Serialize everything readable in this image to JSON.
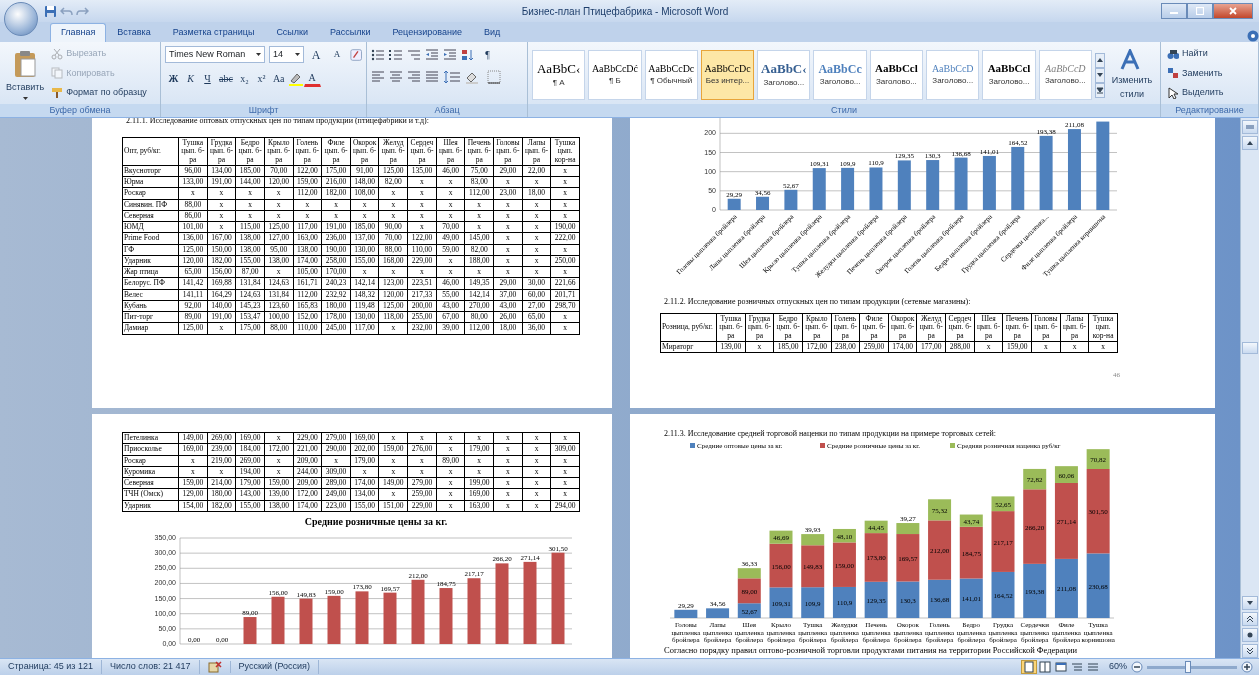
{
  "window": {
    "title": "Бизнес-план Птицефабрика - Microsoft Word"
  },
  "ribbon_tabs": [
    {
      "label": "Главная",
      "selected": true
    },
    {
      "label": "Вставка",
      "selected": false
    },
    {
      "label": "Разметка страницы",
      "selected": false
    },
    {
      "label": "Ссылки",
      "selected": false
    },
    {
      "label": "Рассылки",
      "selected": false
    },
    {
      "label": "Рецензирование",
      "selected": false
    },
    {
      "label": "Вид",
      "selected": false
    }
  ],
  "clipboard": {
    "paste": "Вставить",
    "cut": {
      "label": "Вырезать",
      "disabled": true
    },
    "copy": {
      "label": "Копировать",
      "disabled": true
    },
    "format_painter": {
      "label": "Формат по образцу",
      "disabled": false
    },
    "group_label": "Буфер обмена"
  },
  "font": {
    "name": "Times New Roman",
    "size": "14",
    "grow": "A",
    "shrink": "A",
    "buttons": [
      "Ж",
      "К",
      "Ч",
      "abc",
      "x₂",
      "x²",
      "Aa"
    ],
    "font_color": "A",
    "group_label": "Шрифт"
  },
  "paragraph": {
    "show_marks": "¶",
    "group_label": "Абзац"
  },
  "styles": {
    "items": [
      {
        "preview": "AaBbC‹",
        "name": "¶ А",
        "kind": "large",
        "selected": false
      },
      {
        "preview": "AaBbCcDć",
        "name": "¶ Б",
        "kind": "body",
        "selected": false
      },
      {
        "preview": "AaBbCcDc",
        "name": "¶ Обычный",
        "kind": "body",
        "selected": false
      },
      {
        "preview": "AaBbCcDc",
        "name": "Без интер...",
        "kind": "body",
        "selected": true
      },
      {
        "preview": "AaBbC‹",
        "name": "Заголово...",
        "kind": "heading",
        "selected": false
      },
      {
        "preview": "AaBbCc",
        "name": "Заголово...",
        "kind": "subheading",
        "selected": false
      },
      {
        "preview": "AaBbCcl",
        "name": "Заголово...",
        "kind": "strong",
        "selected": false
      },
      {
        "preview": "AaBbCcD",
        "name": "Заголово...",
        "kind": "subtle",
        "selected": false
      },
      {
        "preview": "AaBbCcl",
        "name": "Заголово...",
        "kind": "strong",
        "selected": false
      },
      {
        "preview": "AaBbCcD",
        "name": "Заголово...",
        "kind": "emphasis",
        "selected": false
      }
    ],
    "change_label": "Изменить стили",
    "group_label": "Стили"
  },
  "editing": {
    "find": "Найти",
    "replace": "Заменить",
    "select": "Выделить",
    "group_label": "Редактирование"
  },
  "wholesale_page": {
    "heading": "2.11.1.    Исследование оптовых отпускных цен по типам продукции (птицефабрики и т.д):",
    "table": {
      "columns": [
        "Опт, руб/кг.",
        "Тушка цып. б-ра",
        "Грудка цып. б-ра",
        "Бедро цып. б-ра",
        "Крыло цып. б-ра",
        "Голень цып. б-ра",
        "Филе цып. б-ра",
        "Окорок цып. б-ра",
        "Желуд цып. б-ра",
        "Сердеч цып. б-ра",
        "Шея цып. б-ра",
        "Печень цып. б-ра",
        "Головы цып. б-ра",
        "Лапы цып. б-ра",
        "Тушка цып. кор-на"
      ],
      "rows": [
        [
          "Вкусноторг",
          "96,00",
          "134,00",
          "185,00",
          "70,00",
          "122,00",
          "175,00",
          "91,00",
          "125,00",
          "135,00",
          "46,00",
          "75,00",
          "29,00",
          "22,00",
          "х"
        ],
        [
          "Юрма",
          "133,00",
          "191,00",
          "144,00",
          "120,00",
          "159,00",
          "216,00",
          "148,00",
          "82,00",
          "х",
          "х",
          "83,00",
          "х",
          "х",
          "х"
        ],
        [
          "Роскар",
          "х",
          "х",
          "х",
          "х",
          "112,00",
          "182,00",
          "108,00",
          "х",
          "х",
          "х",
          "112,00",
          "23,00",
          "18,00",
          "х"
        ],
        [
          "Синявин. ПФ",
          "88,00",
          "х",
          "х",
          "х",
          "х",
          "х",
          "х",
          "х",
          "х",
          "х",
          "х",
          "х",
          "х",
          "х"
        ],
        [
          "Северная",
          "86,00",
          "х",
          "х",
          "х",
          "х",
          "х",
          "х",
          "х",
          "х",
          "х",
          "х",
          "х",
          "х",
          "х"
        ],
        [
          "ЮМД",
          "101,00",
          "х",
          "115,00",
          "125,00",
          "117,00",
          "191,00",
          "185,00",
          "90,00",
          "х",
          "70,00",
          "х",
          "х",
          "х",
          "190,00"
        ],
        [
          "Prime Food",
          "136,00",
          "167,00",
          "138,00",
          "127,00",
          "163,00",
          "236,00",
          "137,00",
          "70,00",
          "122,00",
          "49,00",
          "145,00",
          "х",
          "х",
          "222,00"
        ],
        [
          "ГФ",
          "125,00",
          "150,00",
          "138,00",
          "95,00",
          "138,00",
          "190,00",
          "130,00",
          "88,00",
          "110,00",
          "59,00",
          "82,00",
          "х",
          "х",
          "х"
        ],
        [
          "Ударник",
          "120,00",
          "182,00",
          "155,00",
          "138,00",
          "174,00",
          "258,00",
          "155,00",
          "168,00",
          "229,00",
          "х",
          "188,00",
          "х",
          "х",
          "250,00"
        ],
        [
          "Жар птица",
          "65,00",
          "156,00",
          "87,00",
          "х",
          "105,00",
          "170,00",
          "х",
          "х",
          "х",
          "х",
          "х",
          "х",
          "х",
          "х"
        ],
        [
          "Белорус. ПФ",
          "141,42",
          "169,88",
          "131,84",
          "124,63",
          "161,71",
          "240,23",
          "142,14",
          "123,00",
          "223,51",
          "46,00",
          "149,35",
          "29,00",
          "30,00",
          "221,66"
        ],
        [
          "Велес",
          "141,11",
          "164,29",
          "124,63",
          "131,84",
          "112,00",
          "232,92",
          "148,32",
          "120,00",
          "217,33",
          "55,00",
          "142,14",
          "37,00",
          "60,00",
          "201,71"
        ],
        [
          "Кубань",
          "92,00",
          "140,00",
          "145,23",
          "123,60",
          "165,83",
          "180,00",
          "119,48",
          "125,00",
          "200,00",
          "43,00",
          "270,00",
          "43,00",
          "27,00",
          "298,70"
        ],
        [
          "Пит-торг",
          "89,00",
          "191,00",
          "153,47",
          "100,00",
          "152,00",
          "178,00",
          "130,00",
          "118,00",
          "255,00",
          "67,00",
          "80,00",
          "26,00",
          "65,00",
          "х"
        ],
        [
          "Дамиар",
          "125,00",
          "х",
          "175,00",
          "88,00",
          "110,00",
          "245,00",
          "117,00",
          "х",
          "232,00",
          "39,00",
          "112,00",
          "18,00",
          "36,00",
          "х"
        ]
      ]
    }
  },
  "retail_page": {
    "chart_data": {
      "type": "bar",
      "grid": true,
      "categories": [
        "Головы цыпленка бройлера",
        "Лапы цыпленка бройлера",
        "Шея цыпленка бройлера",
        "Крыло цыпленка бройлера",
        "Тушка цыпленка бройлера",
        "Желудки цыпленка бройлера",
        "Печень цыпленка бройлера",
        "Окорок цыпленка бройлера",
        "Голень цыпленка бройлера",
        "Бедро цыпленка бройлера",
        "Грудка цыпленка бройлера",
        "Сердечки цыпленка...",
        "Филе цыпленка бройлера",
        "Тушка цыпленка корнишона"
      ],
      "values": [
        29.29,
        34.56,
        52.67,
        109.31,
        109.9,
        110.9,
        129.35,
        130.3,
        136.68,
        141.01,
        164.52,
        193.38,
        211.08,
        230.68
      ],
      "value_labels": [
        "29,29",
        "34,56",
        "52,67",
        "109,31",
        "109,9",
        "110,9",
        "129,35",
        "130,3",
        "136,68",
        "141,01",
        "164,52",
        "193,38",
        "211,08",
        null
      ],
      "ylim": [
        0,
        240
      ],
      "yticks": [
        0,
        50,
        100,
        150,
        200
      ]
    },
    "heading": "2.11.2.    Исследование розничных отпускных цен по типам продукции (сетевые магазины):",
    "table": {
      "columns": [
        "Розница, руб/кг.",
        "Тушка цып. б-ра",
        "Грудка цып. б-ра",
        "Бедро цып. б-ра",
        "Крыло цып. б-ра",
        "Голень цып. б-ра",
        "Филе цып. б-ра",
        "Окорок цып. б-ра",
        "Желуд цып. б-ра",
        "Сердеч цып. б-ра",
        "Шея цып. б-ра",
        "Печень цып. б-ра",
        "Головы цып. б-ра",
        "Лапы цып. б-ра",
        "Тушка цып. кор-на"
      ],
      "rows": [
        [
          "Мираторг",
          "139,00",
          "х",
          "185,00",
          "172,00",
          "238,00",
          "259,00",
          "174,00",
          "177,00",
          "288,00",
          "х",
          "159,00",
          "х",
          "х",
          "х"
        ]
      ]
    },
    "page_number": "46"
  },
  "wholesale_continued_page": {
    "table": {
      "rows": [
        [
          "Петелинка",
          "149,00",
          "269,00",
          "169,00",
          "х",
          "229,00",
          "279,00",
          "169,00",
          "х",
          "х",
          "х",
          "х",
          "х",
          "х",
          "х"
        ],
        [
          "Приосколье",
          "169,00",
          "239,00",
          "184,00",
          "172,00",
          "221,00",
          "290,00",
          "202,00",
          "159,00",
          "276,00",
          "х",
          "179,00",
          "х",
          "х",
          "309,00"
        ],
        [
          "Роскар",
          "х",
          "219,00",
          "269,00",
          "х",
          "209,00",
          "х",
          "179,00",
          "х",
          "х",
          "89,00",
          "х",
          "х",
          "х",
          "х"
        ],
        [
          "Куромика",
          "х",
          "х",
          "194,00",
          "х",
          "244,00",
          "309,00",
          "х",
          "х",
          "х",
          "х",
          "х",
          "х",
          "х",
          "х"
        ],
        [
          "Северная",
          "159,00",
          "214,00",
          "179,00",
          "159,00",
          "209,00",
          "289,00",
          "174,00",
          "149,00",
          "279,00",
          "х",
          "199,00",
          "х",
          "х",
          "х"
        ],
        [
          "ТЧН (Омск)",
          "129,00",
          "180,00",
          "143,00",
          "139,00",
          "172,00",
          "249,00",
          "134,00",
          "х",
          "259,00",
          "х",
          "169,00",
          "х",
          "х",
          "х"
        ],
        [
          "Ударник",
          "154,00",
          "182,00",
          "155,00",
          "138,00",
          "174,00",
          "223,00",
          "155,00",
          "151,00",
          "229,00",
          "х",
          "163,00",
          "х",
          "х",
          "294,00"
        ]
      ]
    },
    "chart_data": {
      "type": "bar",
      "grid": true,
      "title": "Средние розничные цены за кг.",
      "values": [
        0,
        0,
        89,
        156,
        149.83,
        159,
        173.8,
        169.57,
        212,
        184.75,
        217.17,
        266.2,
        271.14,
        301.5
      ],
      "value_labels": [
        "0,00",
        "0,00",
        "89,00",
        "156,00",
        "149,83",
        "159,00",
        "173,80",
        "169,57",
        "212,00",
        "184,75",
        "217,17",
        "266,20",
        "271,14",
        "301,50"
      ],
      "ylim": [
        0,
        350
      ],
      "yticks": [
        {
          "value": 0,
          "label": "0,00"
        },
        {
          "value": 50,
          "label": "50,00"
        },
        {
          "value": 100,
          "label": "100,00"
        },
        {
          "value": 150,
          "label": "150,00"
        },
        {
          "value": 200,
          "label": "200,00"
        },
        {
          "value": 250,
          "label": "250,00"
        },
        {
          "value": 300,
          "label": "300,00"
        },
        {
          "value": 350,
          "label": "350,00"
        }
      ]
    }
  },
  "markup_page": {
    "heading": "2.11.3.    Исследование средней торговой наценки по типам продукции на примере торговых сетей:",
    "chart_data": {
      "type": "bar",
      "stacked": true,
      "legend": "top",
      "categories": [
        "Головы цыпленка бройлера",
        "Лапы цыпленка бройлера",
        "Шея цыпленка бройлера",
        "Крыло цыпленка бройлера",
        "Тушка цыпленка бройлера",
        "Желудки цыпленка бройлера",
        "Печень цыпленка бройлера",
        "Окорок цыпленка бройлера",
        "Голень цыпленка бройлера",
        "Бедро цыпленка бройлера",
        "Грудка цыпленка бройлера",
        "Сердечки цыпленка бройлера",
        "Филе цыпленка бройлера",
        "Тушка цыпленка корнишона"
      ],
      "series": [
        {
          "name": "Средние оптовые цены за кг.",
          "color": "#4f81bd",
          "values": [
            29.29,
            34.56,
            52.67,
            109.31,
            109.9,
            110.9,
            129.35,
            130.3,
            136.68,
            141.01,
            164.52,
            193.38,
            211.08,
            230.68
          ],
          "value_labels": [
            "29,29",
            "34,56",
            "52,67",
            "109,31",
            "109,9",
            "110,9",
            "129,35",
            "130,3",
            "136,68",
            "141,01",
            "164,52",
            "193,38",
            "211,08",
            "230,68"
          ]
        },
        {
          "name": "Средние розничные цены за кг.",
          "color": "#c0504d",
          "values": [
            null,
            null,
            89,
            156,
            149.83,
            159,
            173.8,
            169.57,
            212,
            184.75,
            217.17,
            266.2,
            271.14,
            301.5
          ],
          "value_labels": [
            null,
            null,
            "89,00",
            "156,00",
            "149,83",
            "159,00",
            "173,80",
            "169,57",
            "212,00",
            "184,75",
            "217,17",
            "266,20",
            "271,14",
            "301,50"
          ]
        },
        {
          "name": "Средняя розничная наценка руб/кг",
          "color": "#9bbb59",
          "values": [
            null,
            null,
            36.33,
            46.69,
            39.93,
            48.1,
            44.45,
            39.27,
            75.32,
            43.74,
            52.65,
            72.82,
            60.06,
            70.82
          ],
          "value_labels": [
            null,
            null,
            "36,33",
            "46,69",
            "39,93",
            "48,10",
            "44,45",
            "39,27",
            "75,32",
            "43,74",
            "52,65",
            "72,82",
            "60,06",
            "70,82"
          ]
        }
      ]
    },
    "paragraph": "Согласно порядку правил оптово-розничной торговли продуктами питания на территории Российской Федерации"
  },
  "status_bar": {
    "page": "Страница: 45 из 121",
    "words": "Число слов: 21 417",
    "language": "Русский (Россия)",
    "view_buttons": [
      {
        "selected": true
      },
      {
        "selected": false
      },
      {
        "selected": false
      },
      {
        "selected": false
      },
      {
        "selected": false
      }
    ],
    "zoom": "60%",
    "zoom_slider": {
      "level": 0.45
    }
  }
}
